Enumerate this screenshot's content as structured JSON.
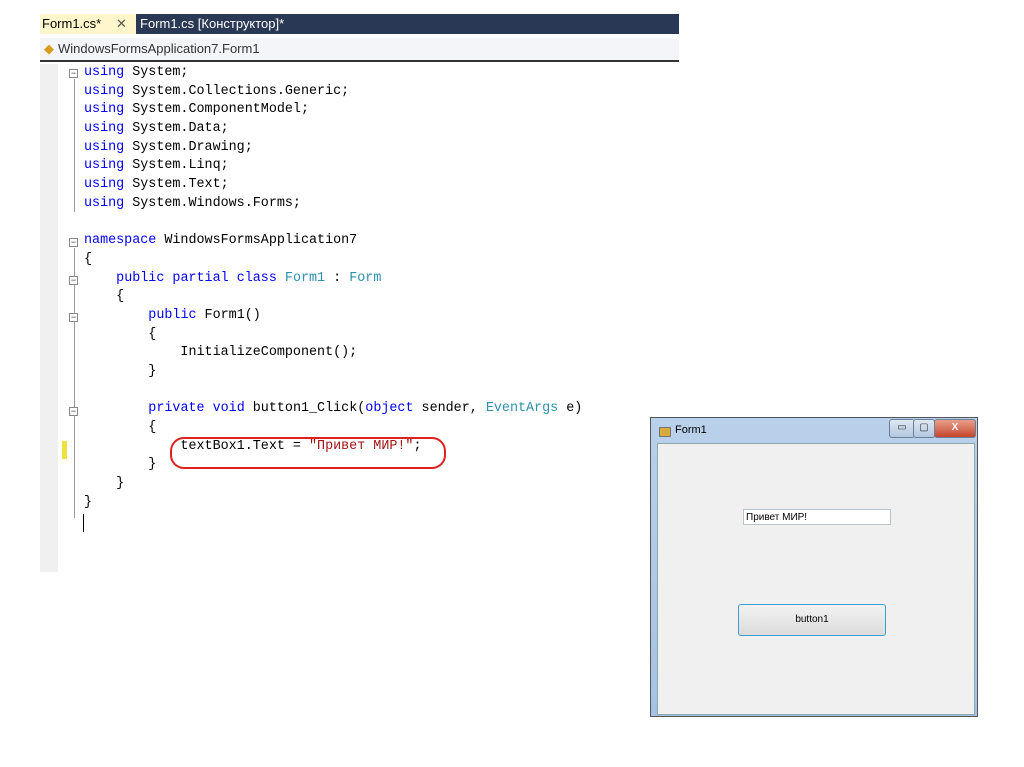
{
  "tabs": {
    "active": "Form1.cs*",
    "close": "✕",
    "designer": "Form1.cs [Конструктор]*"
  },
  "nav": {
    "class_path": "WindowsFormsApplication7.Form1"
  },
  "code_lines": [
    [
      [
        "kw",
        "using"
      ],
      [
        "",
        "System;"
      ]
    ],
    [
      [
        "kw",
        "using"
      ],
      [
        "",
        "System.Collections.Generic;"
      ]
    ],
    [
      [
        "kw",
        "using"
      ],
      [
        "",
        "System.ComponentModel;"
      ]
    ],
    [
      [
        "kw",
        "using"
      ],
      [
        "",
        "System.Data;"
      ]
    ],
    [
      [
        "kw",
        "using"
      ],
      [
        "",
        "System.Drawing;"
      ]
    ],
    [
      [
        "kw",
        "using"
      ],
      [
        "",
        "System.Linq;"
      ]
    ],
    [
      [
        "kw",
        "using"
      ],
      [
        "",
        "System.Text;"
      ]
    ],
    [
      [
        "kw",
        "using"
      ],
      [
        "",
        "System.Windows.Forms;"
      ]
    ],
    [],
    [
      [
        "kw",
        "namespace"
      ],
      [
        "",
        "WindowsFormsApplication7"
      ]
    ],
    [
      [
        "",
        "{"
      ]
    ],
    [
      [
        "",
        "    "
      ],
      [
        "kw",
        "public partial class"
      ],
      [
        "ty",
        "Form1"
      ],
      [
        "",
        ":"
      ],
      [
        "ty",
        "Form"
      ]
    ],
    [
      [
        "",
        "    {"
      ]
    ],
    [
      [
        "",
        "        "
      ],
      [
        "kw",
        "public"
      ],
      [
        "",
        "Form1()"
      ]
    ],
    [
      [
        "",
        "        {"
      ]
    ],
    [
      [
        "",
        "            InitializeComponent();"
      ]
    ],
    [
      [
        "",
        "        }"
      ]
    ],
    [],
    [
      [
        "",
        "        "
      ],
      [
        "kw",
        "private void"
      ],
      [
        "",
        "button1_Click("
      ],
      [
        "kw",
        "object"
      ],
      [
        "",
        "sender,"
      ],
      [
        "ty",
        "EventArgs"
      ],
      [
        "",
        "e)"
      ]
    ],
    [
      [
        "",
        "        {"
      ]
    ],
    [
      [
        "",
        "            textBox1.Text ="
      ],
      [
        "st",
        "\"Привет МИР!\""
      ],
      [
        "",
        ";"
      ]
    ],
    [
      [
        "",
        "        }"
      ]
    ],
    [
      [
        "",
        "    }"
      ]
    ],
    [
      [
        "",
        "}"
      ]
    ]
  ],
  "form": {
    "title": "Form1",
    "minimize": "▭",
    "maximize": "▢",
    "close": "X",
    "textbox_value": "Привет МИР!",
    "button_label": "button1"
  }
}
